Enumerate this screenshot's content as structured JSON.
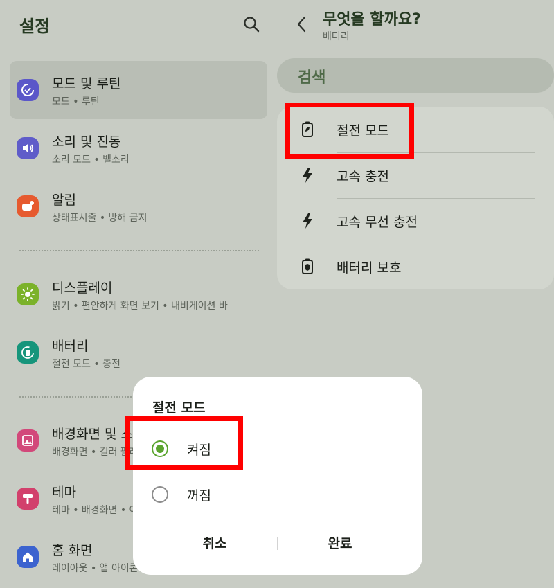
{
  "left": {
    "title": "설정",
    "items": [
      {
        "title": "모드 및 루틴",
        "subtitle": "모드 • 루틴",
        "icon": "modes-routines-icon",
        "color": "#5b57c9",
        "selected": true
      },
      {
        "title": "소리 및 진동",
        "subtitle": "소리 모드 • 벨소리",
        "icon": "sound-icon",
        "color": "#5f5cc9"
      },
      {
        "title": "알림",
        "subtitle": "상태표시줄 • 방해 금지",
        "icon": "notification-icon",
        "color": "#e65a2f"
      },
      {
        "title": "디스플레이",
        "subtitle": "밝기 • 편안하게 화면 보기 • 내비게이션 바",
        "icon": "display-icon",
        "color": "#7bb22a"
      },
      {
        "title": "배터리",
        "subtitle": "절전 모드 • 충전",
        "icon": "battery-icon",
        "color": "#16957b"
      },
      {
        "title": "배경화면 및 스타일",
        "subtitle": "배경화면 • 컬러 팔레트",
        "icon": "wallpaper-icon",
        "color": "#d2487a"
      },
      {
        "title": "테마",
        "subtitle": "테마 • 배경화면 • 아이콘",
        "icon": "theme-icon",
        "color": "#d2406c"
      },
      {
        "title": "홈 화면",
        "subtitle": "레이아웃 • 앱 아이콘 배지",
        "icon": "home-icon",
        "color": "#3c63cf"
      }
    ]
  },
  "right": {
    "title": "무엇을 할까요?",
    "subtitle": "배터리",
    "search_label": "검색",
    "results": [
      {
        "label": "절전 모드",
        "icon": "power-saving-icon"
      },
      {
        "label": "고속 충전",
        "icon": "fast-charging-icon"
      },
      {
        "label": "고속 무선 충전",
        "icon": "fast-wireless-charging-icon"
      },
      {
        "label": "배터리 보호",
        "icon": "battery-protection-icon"
      }
    ]
  },
  "dialog": {
    "title": "절전 모드",
    "options": [
      {
        "label": "켜짐",
        "checked": true
      },
      {
        "label": "꺼짐",
        "checked": false
      }
    ],
    "cancel_label": "취소",
    "done_label": "완료"
  },
  "colors": {
    "highlight": "#ff0000",
    "radio_accent": "#5aa42e"
  }
}
